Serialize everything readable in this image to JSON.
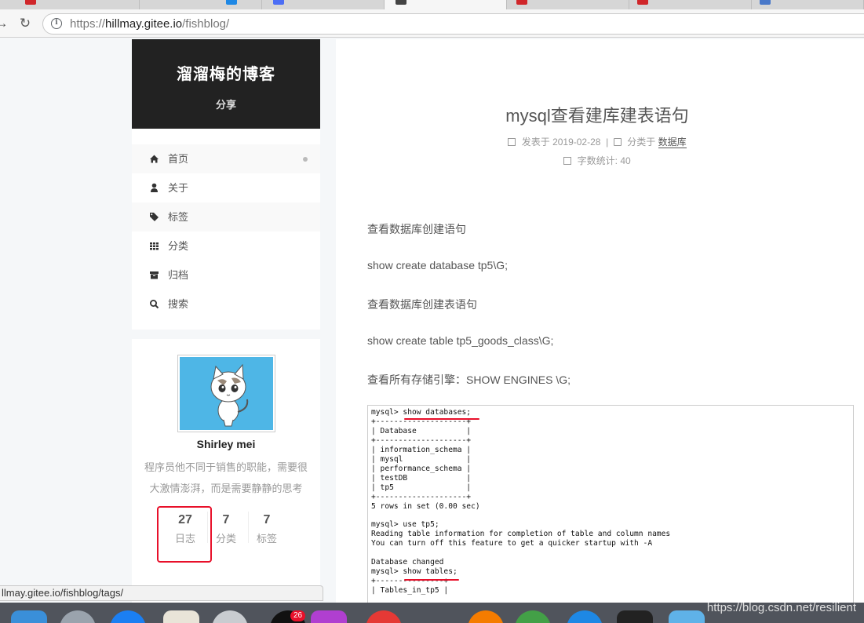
{
  "browser": {
    "url_prefix": "https://",
    "url_host": "hillmay.gitee.io",
    "url_path": "/fishblog/",
    "status_url": "llmay.gitee.io/fishblog/tags/"
  },
  "site": {
    "title": "溜溜梅的博客",
    "subtitle": "分享"
  },
  "menu": [
    {
      "label": "首页",
      "icon": "home-icon"
    },
    {
      "label": "关于",
      "icon": "user-icon"
    },
    {
      "label": "标签",
      "icon": "tags-icon"
    },
    {
      "label": "分类",
      "icon": "grid-icon"
    },
    {
      "label": "归档",
      "icon": "archive-icon"
    },
    {
      "label": "搜索",
      "icon": "search-icon"
    }
  ],
  "profile": {
    "name": "Shirley mei",
    "description": "程序员他不同于销售的职能，需要很大激情澎湃，而是需要静静的思考",
    "stats": [
      {
        "value": "27",
        "label": "日志"
      },
      {
        "value": "7",
        "label": "分类"
      },
      {
        "value": "7",
        "label": "标签"
      }
    ]
  },
  "post": {
    "title": "mysql查看建库建表语句",
    "published_label": "发表于",
    "published_date": "2019-02-28",
    "separator": "|",
    "category_label": "分类于",
    "category": "数据库",
    "wordcount_label": "字数统计:",
    "wordcount": "40",
    "paragraphs": [
      "查看数据库创建语句",
      "show create database tp5\\G;",
      "查看数据库创建表语句",
      "show create table tp5_goods_class\\G;",
      "查看所有存储引擎：SHOW ENGINES \\G;"
    ],
    "terminal": "mysql> show databases;\n+--------------------+\n| Database           |\n+--------------------+\n| information_schema |\n| mysql              |\n| performance_schema |\n| testDB             |\n| tp5                |\n+--------------------+\n5 rows in set (0.00 sec)\n\nmysql> use tp5;\nReading table information for completion of table and column names\nYou can turn off this feature to get a quicker startup with -A\n\nDatabase changed\nmysql> show tables;\n+---------------+\n| Tables_in_tp5 |"
  },
  "watermark": "https://blog.csdn.net/resilient",
  "dock_badge": "26",
  "colors": {
    "header_bg": "#222222",
    "highlight_red": "#e8102a",
    "avatar_bg": "#4eb6e6"
  }
}
